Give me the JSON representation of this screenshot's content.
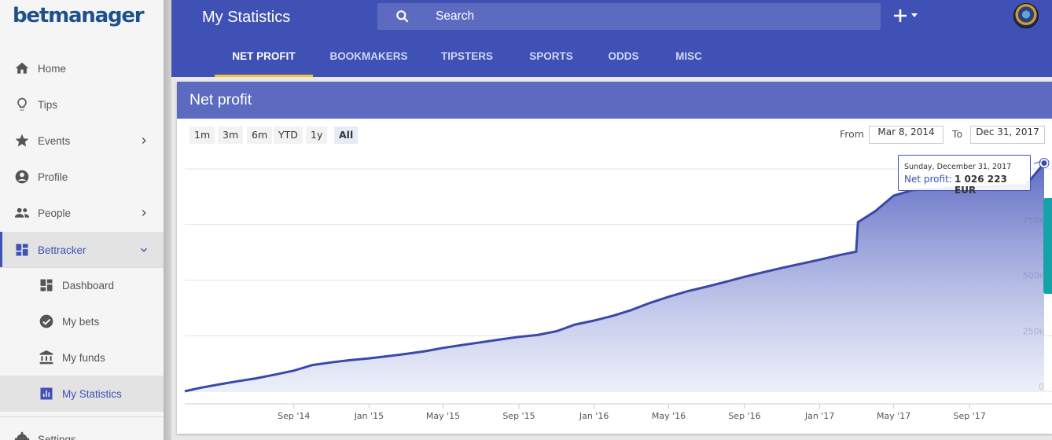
{
  "sidebar": {
    "logo": "betmanager",
    "items": [
      {
        "label": "Home",
        "icon": "home-icon"
      },
      {
        "label": "Tips",
        "icon": "lightbulb-icon"
      },
      {
        "label": "Events",
        "icon": "star-icon"
      },
      {
        "label": "Profile",
        "icon": "account-circle-icon"
      },
      {
        "label": "People",
        "icon": "people-icon"
      },
      {
        "label": "Bettracker",
        "icon": "dashboard-icon"
      }
    ],
    "subitems": [
      {
        "label": "Dashboard",
        "icon": "dashboard-icon"
      },
      {
        "label": "My bets",
        "icon": "check-circle-icon"
      },
      {
        "label": "My funds",
        "icon": "bank-icon"
      },
      {
        "label": "My Statistics",
        "icon": "bar-chart-icon"
      }
    ],
    "footer_item": {
      "label": "Settings",
      "icon": "gear-icon"
    }
  },
  "header": {
    "title": "My Statistics",
    "search_placeholder": "Search",
    "add_icon": "plus-icon",
    "tabs": [
      {
        "label": "NET PROFIT"
      },
      {
        "label": "BOOKMAKERS"
      },
      {
        "label": "TIPSTERS"
      },
      {
        "label": "SPORTS"
      },
      {
        "label": "ODDS"
      },
      {
        "label": "MISC"
      }
    ],
    "active_tab": "NET PROFIT"
  },
  "card": {
    "title": "Net profit",
    "range_buttons": [
      "1m",
      "3m",
      "6m",
      "YTD",
      "1y",
      "All"
    ],
    "selected_range": "All",
    "from_label": "From",
    "from_value": "Mar 8, 2014",
    "to_label": "To",
    "to_value": "Dec 31, 2017"
  },
  "tooltip": {
    "date": "Sunday, December 31, 2017",
    "series": "Net profit:",
    "value": "1 026 223 EUR"
  },
  "colors": {
    "primary": "#3f51b5",
    "card_header": "#5c6bc0",
    "tab_indicator": "#f3c22d",
    "line": "#3949ab",
    "side_widget": "#14a3a8"
  },
  "chart_data": {
    "type": "area",
    "series": [
      {
        "name": "Net profit",
        "x": [
          "2014-03-08",
          "2014-04-01",
          "2014-05-01",
          "2014-06-01",
          "2014-07-01",
          "2014-08-01",
          "2014-09-01",
          "2014-10-01",
          "2014-11-01",
          "2014-12-01",
          "2015-01-01",
          "2015-02-01",
          "2015-03-01",
          "2015-04-01",
          "2015-05-01",
          "2015-06-01",
          "2015-07-01",
          "2015-08-01",
          "2015-09-01",
          "2015-10-01",
          "2015-11-01",
          "2015-12-01",
          "2016-01-01",
          "2016-02-01",
          "2016-03-01",
          "2016-04-01",
          "2016-05-01",
          "2016-06-01",
          "2016-07-01",
          "2016-08-01",
          "2016-09-01",
          "2016-10-01",
          "2016-11-01",
          "2016-12-01",
          "2017-01-01",
          "2017-02-01",
          "2017-03-01",
          "2017-03-04",
          "2017-04-01",
          "2017-05-01",
          "2017-06-01",
          "2017-07-01",
          "2017-08-01",
          "2017-09-01",
          "2017-10-01",
          "2017-11-01",
          "2017-12-01",
          "2017-12-31"
        ],
        "values": [
          0,
          15000,
          30000,
          45000,
          58000,
          75000,
          93000,
          118000,
          130000,
          140000,
          148000,
          158000,
          168000,
          180000,
          195000,
          208000,
          220000,
          233000,
          245000,
          253000,
          270000,
          300000,
          318000,
          340000,
          365000,
          398000,
          425000,
          450000,
          470000,
          492000,
          515000,
          535000,
          555000,
          573000,
          592000,
          612000,
          628000,
          760000,
          810000,
          880000,
          905000,
          910000,
          914000,
          918000,
          921000,
          923000,
          925000,
          1026223
        ]
      }
    ],
    "x_ticks": [
      "Sep '14",
      "Jan '15",
      "May '15",
      "Sep '15",
      "Jan '16",
      "May '16",
      "Sep '16",
      "Jan '17",
      "May '17",
      "Sep '17"
    ],
    "y_ticks": [
      "0",
      "250k",
      "500k",
      "750k"
    ],
    "ylim": [
      0,
      1000000
    ],
    "grid": true,
    "legend": "none"
  }
}
